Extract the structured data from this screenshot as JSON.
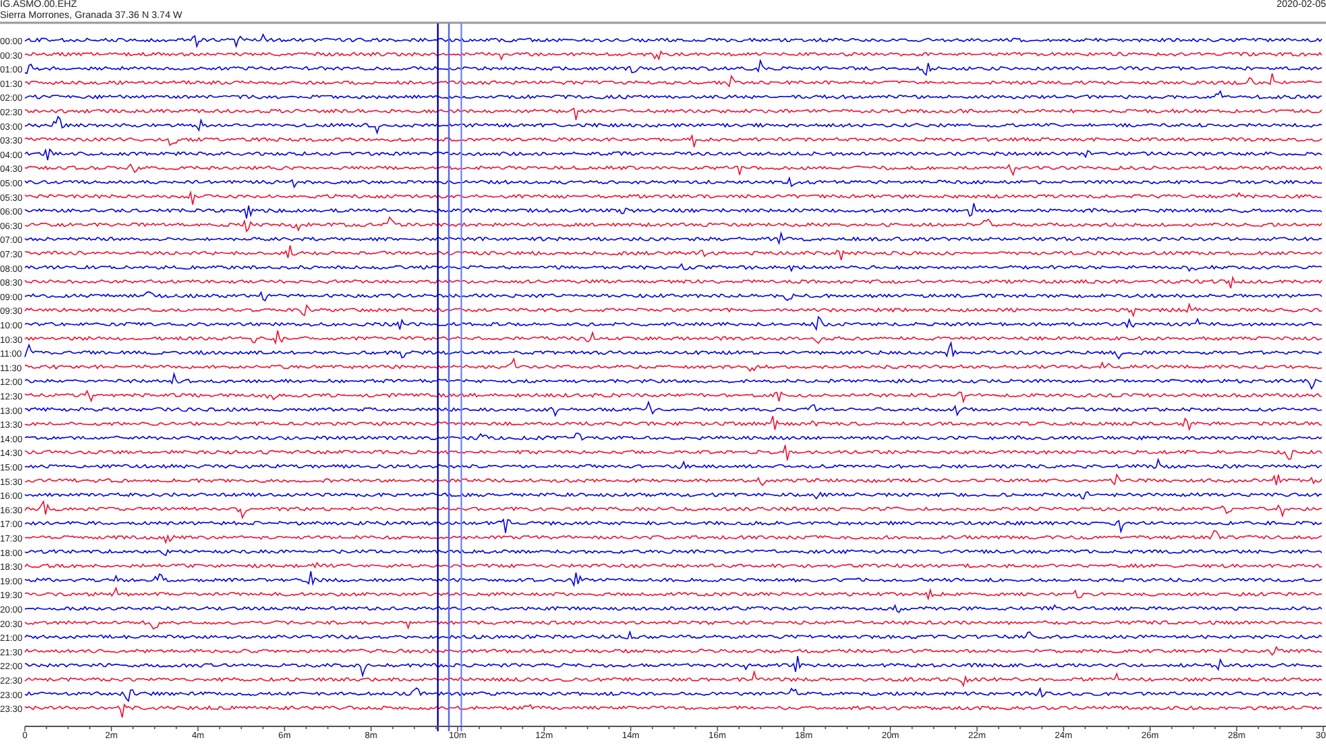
{
  "header": {
    "station": "IG.ASMO.00.EHZ",
    "location": "Sierra Morrones, Granada  37.36 N 3.74 W",
    "date": "2020-02-05"
  },
  "rows": [
    {
      "label": "00:00",
      "color": "#0000dd"
    },
    {
      "label": "00:30",
      "color": "#ee1133"
    },
    {
      "label": "01:00",
      "color": "#0000dd"
    },
    {
      "label": "01:30",
      "color": "#ee1133"
    },
    {
      "label": "02:00",
      "color": "#0000dd"
    },
    {
      "label": "02:30",
      "color": "#ee1133"
    },
    {
      "label": "03:00",
      "color": "#0000dd"
    },
    {
      "label": "03:30",
      "color": "#ee1133"
    },
    {
      "label": "04:00",
      "color": "#0000dd"
    },
    {
      "label": "04:30",
      "color": "#ee1133"
    },
    {
      "label": "05:00",
      "color": "#0000dd"
    },
    {
      "label": "05:30",
      "color": "#ee1133"
    },
    {
      "label": "06:00",
      "color": "#0000dd"
    },
    {
      "label": "06:30",
      "color": "#ee1133"
    },
    {
      "label": "07:00",
      "color": "#0000dd"
    },
    {
      "label": "07:30",
      "color": "#ee1133"
    },
    {
      "label": "08:00",
      "color": "#0000dd"
    },
    {
      "label": "08:30",
      "color": "#ee1133"
    },
    {
      "label": "09:00",
      "color": "#0000dd"
    },
    {
      "label": "09:30",
      "color": "#ee1133"
    },
    {
      "label": "10:00",
      "color": "#0000dd"
    },
    {
      "label": "10:30",
      "color": "#ee1133"
    },
    {
      "label": "11:00",
      "color": "#0000dd"
    },
    {
      "label": "11:30",
      "color": "#ee1133"
    },
    {
      "label": "12:00",
      "color": "#0000dd"
    },
    {
      "label": "12:30",
      "color": "#ee1133"
    },
    {
      "label": "13:00",
      "color": "#0000dd"
    },
    {
      "label": "13:30",
      "color": "#ee1133"
    },
    {
      "label": "14:00",
      "color": "#0000dd"
    },
    {
      "label": "14:30",
      "color": "#ee1133"
    },
    {
      "label": "15:00",
      "color": "#0000dd"
    },
    {
      "label": "15:30",
      "color": "#ee1133"
    },
    {
      "label": "16:00",
      "color": "#0000dd"
    },
    {
      "label": "16:30",
      "color": "#ee1133"
    },
    {
      "label": "17:00",
      "color": "#0000dd"
    },
    {
      "label": "17:30",
      "color": "#ee1133"
    },
    {
      "label": "18:00",
      "color": "#0000dd"
    },
    {
      "label": "18:30",
      "color": "#ee1133"
    },
    {
      "label": "19:00",
      "color": "#0000dd"
    },
    {
      "label": "19:30",
      "color": "#ee1133"
    },
    {
      "label": "20:00",
      "color": "#0000dd"
    },
    {
      "label": "20:30",
      "color": "#ee1133"
    },
    {
      "label": "21:00",
      "color": "#0000dd"
    },
    {
      "label": "21:30",
      "color": "#ee1133"
    },
    {
      "label": "22:00",
      "color": "#0000dd"
    },
    {
      "label": "22:30",
      "color": "#ee1133"
    },
    {
      "label": "23:00",
      "color": "#0000dd"
    },
    {
      "label": "23:30",
      "color": "#ee1133"
    }
  ],
  "x_axis": {
    "labels": [
      "0",
      "2m",
      "4m",
      "6m",
      "8m",
      "10m",
      "12m",
      "14m",
      "16m",
      "18m",
      "20m",
      "22m",
      "24m",
      "26m",
      "28m",
      "30"
    ]
  }
}
